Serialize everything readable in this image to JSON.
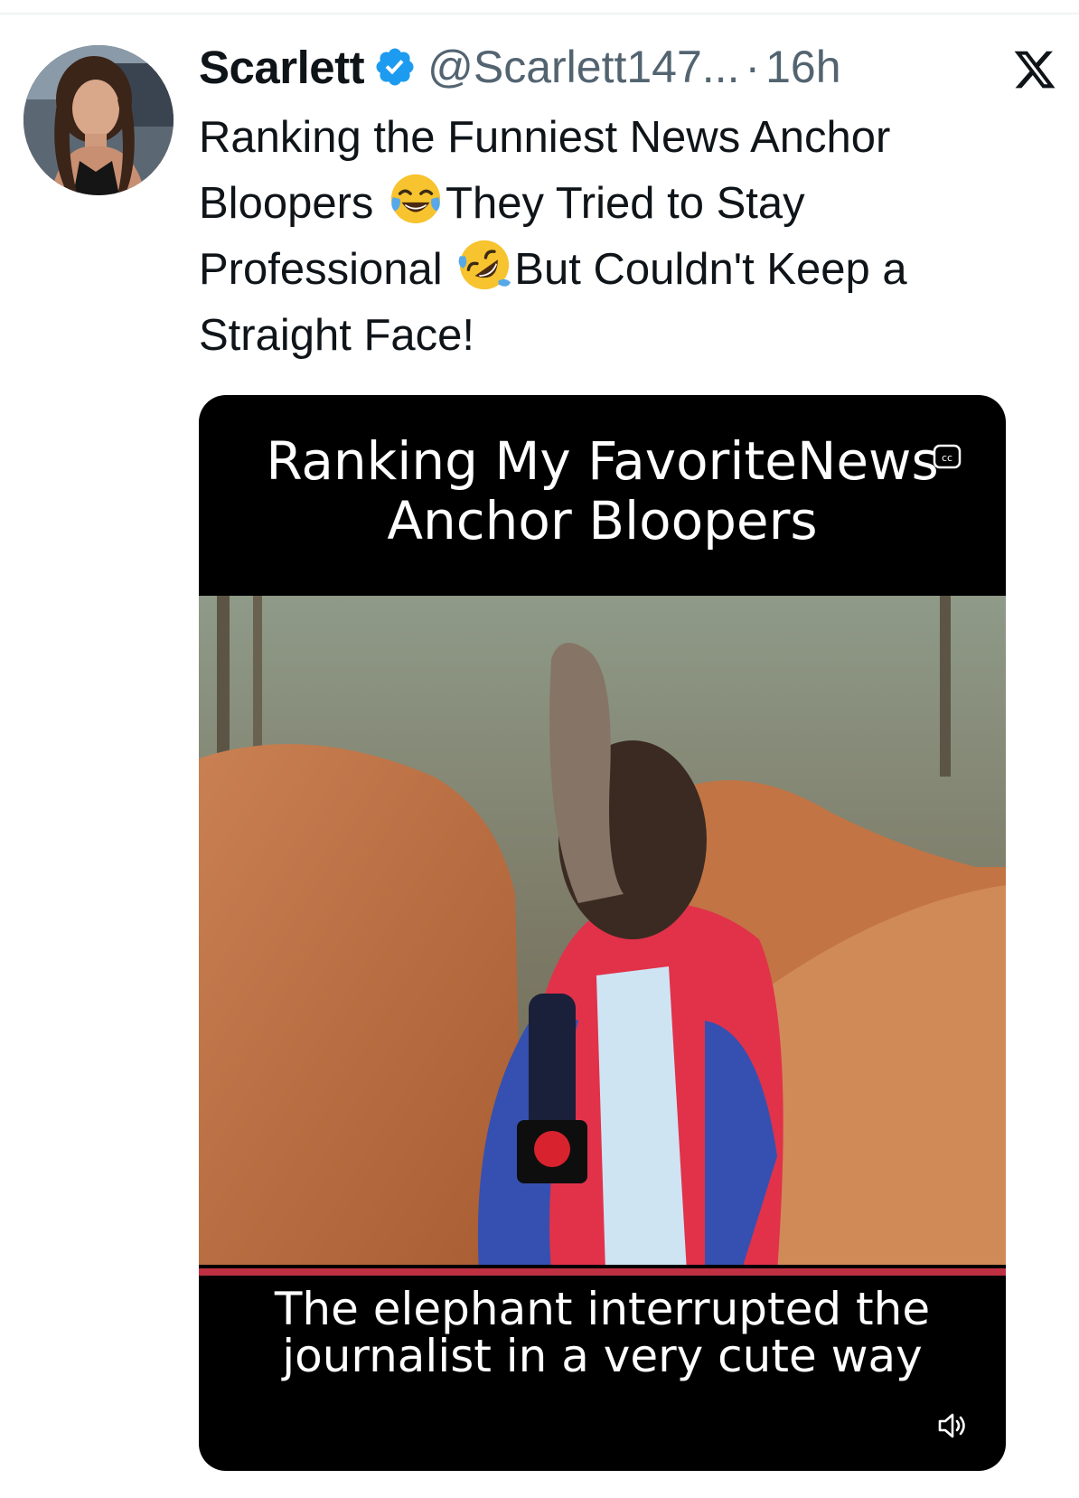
{
  "post": {
    "display_name": "Scarlett",
    "handle": "@Scarlett147...",
    "separator": "·",
    "time": "16h",
    "text_part1": "Ranking the Funniest News Anchor Bloopers",
    "text_part2": "They Tried to Stay Professional",
    "text_part3": "But Couldn't Keep a Straight Face!",
    "emoji1": "face-with-tears-of-joy-icon",
    "emoji2": "rolling-on-the-floor-laughing-icon"
  },
  "media": {
    "title_line1": "Ranking My FavoriteNews",
    "title_line2": "Anchor Bloopers",
    "caption_line1": "The elephant interrupted the",
    "caption_line2": "journalist in a very cute way",
    "cc_icon": "closed-captions-icon",
    "sound_icon": "speaker-icon"
  },
  "colors": {
    "text_primary": "#0f1419",
    "text_secondary": "#536471",
    "verified_blue": "#1d9bf0",
    "media_background": "#000000",
    "progress_red": "#e0384f"
  }
}
